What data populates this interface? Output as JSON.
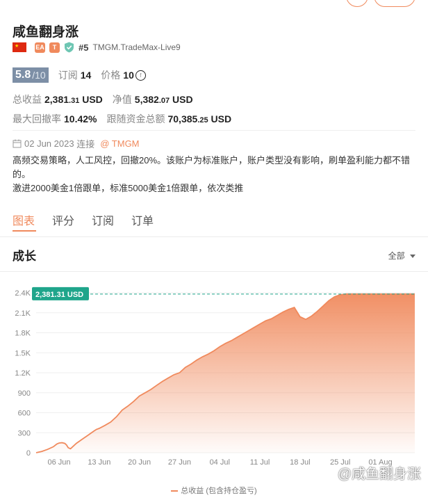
{
  "header": {
    "title": "咸鱼翻身涨",
    "tag_ea": "EA",
    "tag_t": "T",
    "rank": "#5",
    "server": "TMGM.TradeMax-Live9"
  },
  "score": {
    "value": "5.8",
    "max": "/10"
  },
  "subs": {
    "label": "订阅",
    "value": "14"
  },
  "price": {
    "label": "价格",
    "value": "10",
    "icon_glyph": "f"
  },
  "stats": {
    "total_profit_label": "总收益",
    "total_profit_main": "2,381",
    "total_profit_dec": ".31",
    "total_profit_unit": " USD",
    "equity_label": "净值",
    "equity_main": "5,382",
    "equity_dec": ".07",
    "equity_unit": " USD",
    "drawdown_label": "最大回撤率",
    "drawdown_value": "10.42%",
    "follow_label": "跟随资金总额",
    "follow_main": "70,385",
    "follow_dec": ".25",
    "follow_unit": " USD"
  },
  "since": {
    "date": "02 Jun 2023",
    "connect": "连接",
    "broker": "@ TMGM"
  },
  "description": {
    "line1": "高频交易策略，人工风控，回撤20%。该账户为标准账户，账户类型没有影响，刷单盈利能力都不错的。",
    "line2": "激进2000美金1倍跟单，标准5000美金1倍跟单，依次类推"
  },
  "tabs": [
    "图表",
    "评分",
    "订阅",
    "订单"
  ],
  "section": {
    "title": "成长",
    "range": "全部"
  },
  "icons": {
    "calendar": "calendar-icon",
    "shield": "verified-shield-icon",
    "dropdown": "caret-down-icon"
  },
  "colors": {
    "accent": "#f08a5d",
    "tooltip": "#1fa58b",
    "score_bg": "#7d8fa6",
    "flag": "#de2910"
  },
  "chart_data": {
    "type": "area",
    "ylim": [
      0,
      2400
    ],
    "yticks": [
      0,
      300,
      600,
      900,
      1200,
      1500,
      1800,
      2100,
      2400
    ],
    "ytick_labels": [
      "0",
      "300",
      "600",
      "900",
      "1.2K",
      "1.5K",
      "1.8K",
      "2.1K",
      "2.4K"
    ],
    "x_ticks": [
      "06 Jun",
      "13 Jun",
      "20 Jun",
      "27 Jun",
      "04 Jul",
      "11 Jul",
      "18 Jul",
      "25 Jul",
      "01 Aug"
    ],
    "x": [
      0,
      1,
      2,
      3,
      3.6,
      4,
      4.5,
      5,
      5.3,
      5.6,
      6,
      7,
      8,
      9,
      10,
      10.5,
      11,
      12,
      13,
      14,
      15,
      16,
      17,
      18,
      19,
      20,
      21,
      22,
      23,
      24,
      25,
      26,
      27,
      28,
      29,
      30,
      31,
      32,
      33,
      34,
      35,
      36,
      37,
      38,
      39,
      40,
      41,
      42,
      43,
      44,
      45,
      46,
      47,
      48,
      49,
      50,
      51,
      52,
      53,
      54,
      55,
      56,
      57,
      58,
      59,
      60,
      60.5,
      61,
      62,
      63,
      64,
      65,
      66
    ],
    "values": [
      0,
      20,
      50,
      90,
      130,
      145,
      150,
      140,
      115,
      75,
      60,
      140,
      200,
      260,
      320,
      350,
      365,
      410,
      460,
      540,
      640,
      700,
      770,
      850,
      900,
      950,
      1010,
      1070,
      1120,
      1170,
      1200,
      1280,
      1330,
      1390,
      1440,
      1480,
      1530,
      1590,
      1640,
      1680,
      1730,
      1780,
      1830,
      1880,
      1930,
      1980,
      2010,
      2060,
      2110,
      2150,
      2180,
      2040,
      2000,
      2050,
      2120,
      2200,
      2280,
      2340,
      2370,
      2381,
      2381,
      2381,
      2381,
      2381,
      2381,
      2381,
      2381,
      2381,
      2381,
      2381,
      2381,
      2381,
      2381
    ],
    "series_name": "总收益 (包含持仓盈亏)",
    "tooltip": "2,381.31 USD"
  },
  "watermark": "@咸鱼翻身涨"
}
